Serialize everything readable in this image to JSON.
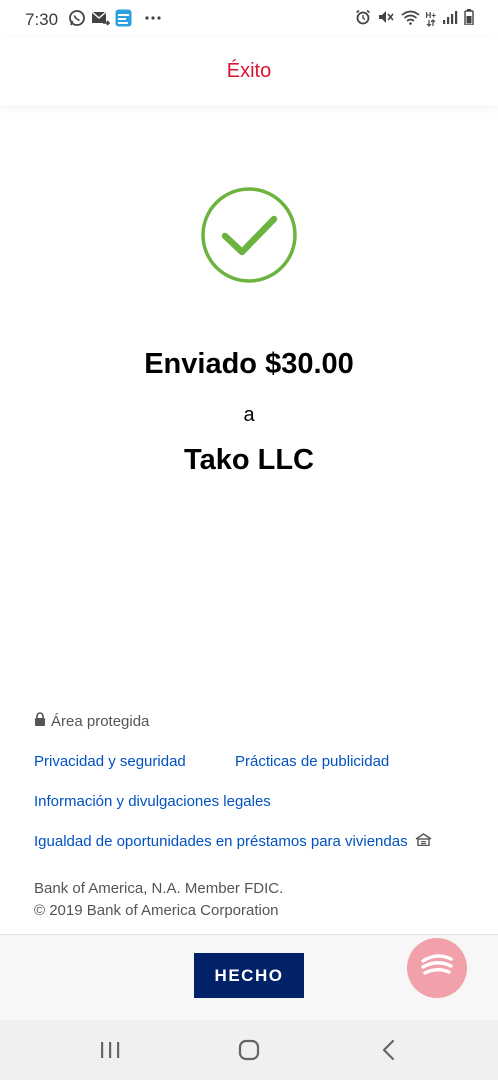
{
  "status_bar": {
    "time": "7:30",
    "left_icons": [
      "whatsapp-icon",
      "email-forward-icon",
      "app-notification-icon",
      "more-notifications-icon"
    ],
    "right_icons": [
      "alarm-icon",
      "mute-icon",
      "wifi-icon",
      "network-icon",
      "signal-icon",
      "battery-icon"
    ],
    "network_label": "H+"
  },
  "header": {
    "title": "Éxito",
    "title_color": "#dc1431"
  },
  "confirmation": {
    "icon": "checkmark-circle-icon",
    "icon_color": "#6db33f",
    "amount_line": "Enviado $30.00",
    "connector": "a",
    "recipient": "Tako LLC"
  },
  "footer": {
    "secure_label": "Área protegida",
    "links": {
      "privacy": "Privacidad y seguridad",
      "advertising": "Prácticas de publicidad",
      "legal": "Información y divulgaciones legales",
      "housing": "Igualdad de oportunidades en préstamos para viviendas"
    },
    "fdic": "Bank of America, N.A. Member FDIC.",
    "copyright": "© 2019 Bank of America Corporation",
    "link_color": "#0052c2"
  },
  "actions": {
    "done_label": "HECHO",
    "done_color": "#012169",
    "fab_color": "#f2a0aa"
  },
  "nav": {
    "icons": [
      "recent-apps-icon",
      "home-icon",
      "back-icon"
    ]
  }
}
